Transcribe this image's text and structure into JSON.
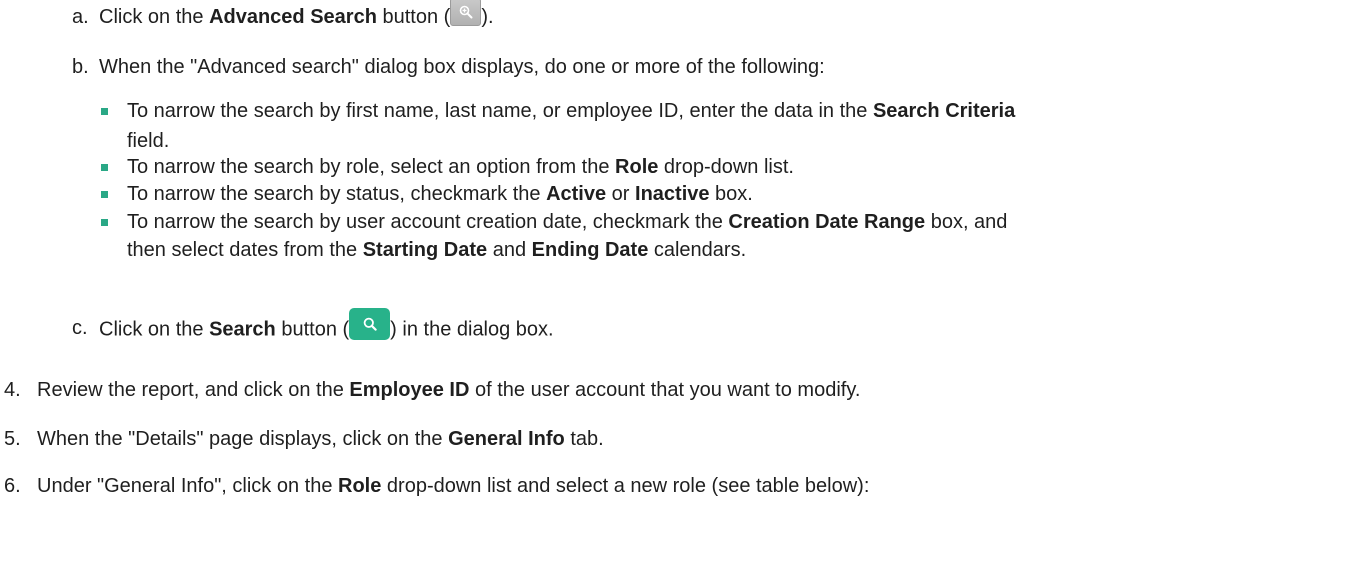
{
  "steps": {
    "a": {
      "marker": "a.",
      "pre": "Click on the ",
      "bold": "Advanced Search",
      "mid": " button (",
      "post": ").",
      "icon": "zoom-in-magnifier-icon"
    },
    "b": {
      "marker": "b.",
      "text": "When the \"Advanced search\" dialog box displays, do one or more of the following:",
      "bullets": [
        {
          "line1_pre": "To narrow the search by first name, last name, or employee ID, enter the data in the ",
          "line1_bold": "Search Criteria",
          "line2": "field."
        },
        {
          "pre": "To narrow the search by role, select an option from the ",
          "bold": "Role",
          "post": " drop-down list."
        },
        {
          "pre": "To narrow the search by status, checkmark the ",
          "bold1": "Active",
          "mid": " or ",
          "bold2": "Inactive",
          "post": " box."
        },
        {
          "line1_pre": "To narrow the search by user account creation date, checkmark the ",
          "line1_bold": "Creation Date Range",
          "line1_post": " box, and",
          "line2_pre": "then select dates from the ",
          "line2_bold1": "Starting Date",
          "line2_mid": " and ",
          "line2_bold2": "Ending Date",
          "line2_post": " calendars."
        }
      ]
    },
    "c": {
      "marker": "c.",
      "pre": "Click on the ",
      "bold": "Search",
      "mid": " button (",
      "post": ") in the dialog box.",
      "icon": "search-magnifier-icon"
    },
    "s4": {
      "marker": "4.",
      "pre": "Review the report, and click on the ",
      "bold": "Employee ID",
      "post": " of the user account that you want to modify."
    },
    "s5": {
      "marker": "5.",
      "pre": "When the \"Details\" page displays, click on the ",
      "bold": "General Info",
      "post": " tab."
    },
    "s6": {
      "marker": "6.",
      "pre": "Under \"General Info\", click on the ",
      "bold": "Role",
      "post": " drop-down list and select a new role (see table below):"
    }
  },
  "colors": {
    "bullet": "#2aa886",
    "search_button": "#28b28a",
    "advanced_button": "#bdbdbd"
  }
}
